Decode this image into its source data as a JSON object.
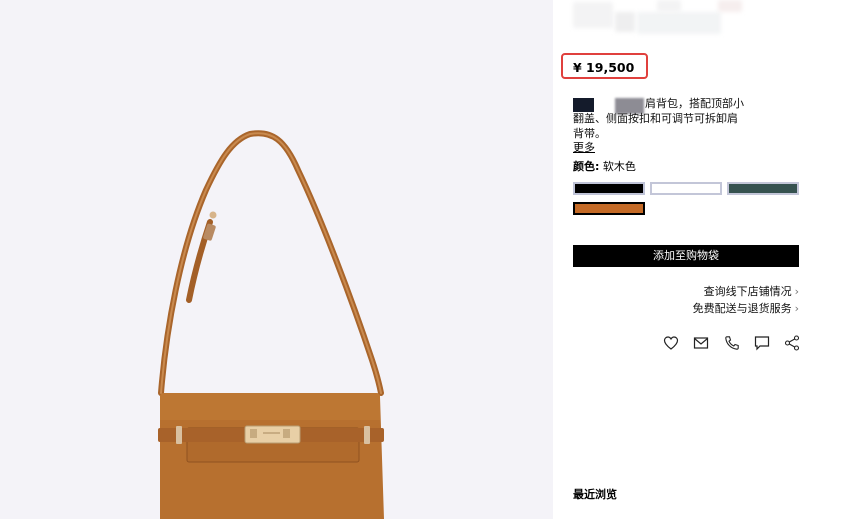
{
  "product": {
    "price": "¥ 19,500",
    "description_lines": [
      "肩背包，搭配顶部小",
      "翻盖、侧面按扣和可调节可拆卸肩",
      "背带。"
    ],
    "more_label": "更多",
    "color_label": "颜色:",
    "color_value": "软木色",
    "swatches": [
      {
        "name": "black",
        "color": "#000000"
      },
      {
        "name": "white",
        "color": "#ffffff"
      },
      {
        "name": "dark-green",
        "color": "#36524f"
      },
      {
        "name": "tan",
        "color": "#c46a26",
        "selected": true
      }
    ],
    "add_to_bag_label": "添加至购物袋"
  },
  "links": {
    "store_availability": "查询线下店铺情况",
    "shipping_returns": "免费配送与退货服务"
  },
  "actions": [
    "heart-icon",
    "mail-icon",
    "phone-icon",
    "chat-icon",
    "share-icon"
  ],
  "recent": {
    "title": "最近浏览"
  },
  "colors": {
    "price_highlight": "#e0403d",
    "image_background": "#f4f3f8",
    "leather": "#b7702f"
  }
}
